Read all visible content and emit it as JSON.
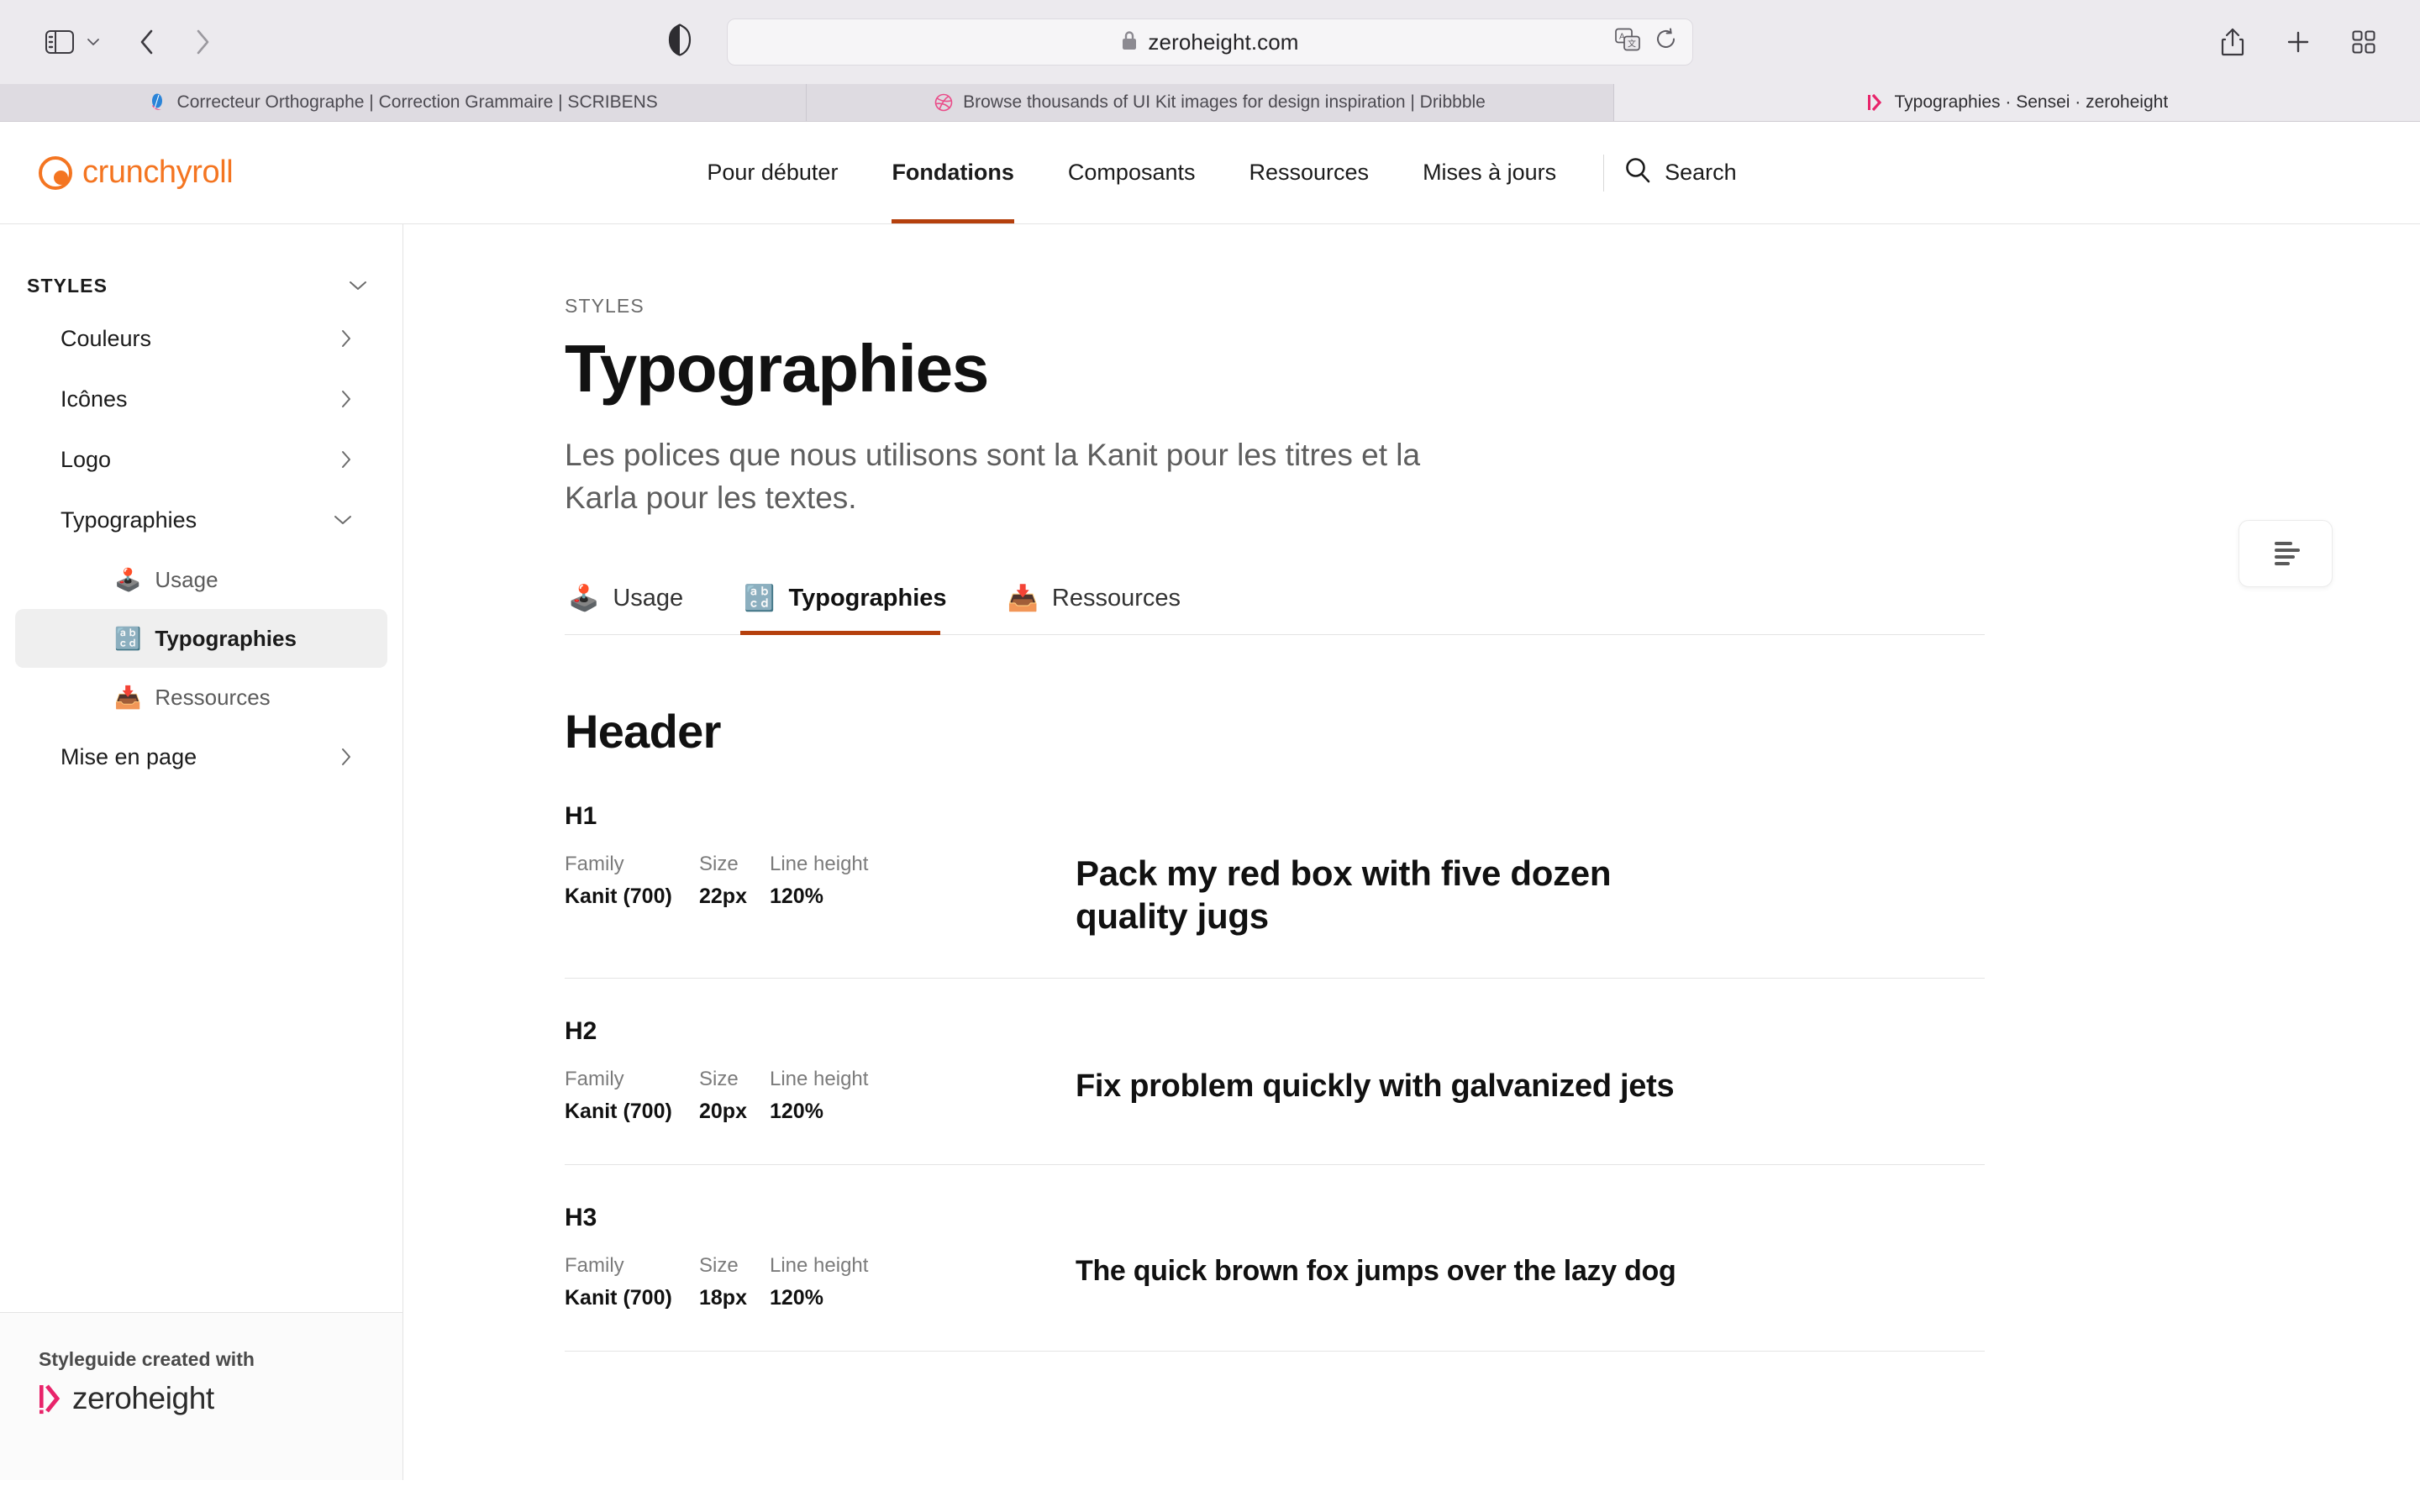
{
  "browser": {
    "url": "zeroheight.com",
    "url_lock_icon": "lock-icon",
    "translate_icon": "translate-icon",
    "reload_icon": "reload-icon",
    "share_icon": "share-icon",
    "new_tab_icon": "plus-icon",
    "tab_overview_icon": "tab-overview-icon",
    "sidebar_icon": "sidebar-toggle-icon",
    "back_icon": "back-arrow-icon",
    "forward_icon": "forward-arrow-icon",
    "shield_icon": "privacy-shield-icon",
    "tabs": [
      {
        "title": "Correcteur Orthographe | Correction Grammaire | SCRIBENS",
        "favicon": "scribens-favicon",
        "active": false
      },
      {
        "title": "Browse thousands of UI Kit images for design inspiration | Dribbble",
        "favicon": "dribbble-favicon",
        "active": false
      },
      {
        "title": "Typographies · Sensei  · zeroheight",
        "favicon": "zeroheight-favicon",
        "active": true
      }
    ]
  },
  "site_header": {
    "brand": "crunchyroll",
    "brand_color": "#F47521",
    "accent_color": "#B5400D",
    "nav": [
      {
        "label": "Pour débuter",
        "active": false
      },
      {
        "label": "Fondations",
        "active": true
      },
      {
        "label": "Composants",
        "active": false
      },
      {
        "label": "Ressources",
        "active": false
      },
      {
        "label": "Mises à jours",
        "active": false
      }
    ],
    "search_label": "Search",
    "search_icon": "search-icon"
  },
  "sidebar": {
    "group_label": "STYLES",
    "group_chevron": "chevron-down-icon",
    "items": [
      {
        "label": "Couleurs",
        "chevron": "chevron-right-icon"
      },
      {
        "label": "Icônes",
        "chevron": "chevron-right-icon"
      },
      {
        "label": "Logo",
        "chevron": "chevron-right-icon"
      },
      {
        "label": "Typographies",
        "chevron": "chevron-down-icon"
      }
    ],
    "sub_items": [
      {
        "label": "Usage",
        "emoji": "🕹️",
        "icon_name": "joystick-emoji",
        "active": false
      },
      {
        "label": "Typographies",
        "emoji": "🔡",
        "icon_name": "abcd-input-emoji",
        "active": true
      },
      {
        "label": "Ressources",
        "emoji": "📥",
        "icon_name": "inbox-tray-emoji",
        "active": false
      }
    ],
    "last_item": {
      "label": "Mise en page",
      "chevron": "chevron-right-icon"
    },
    "footer": {
      "created_with": "Styleguide created with",
      "product": "zeroheight",
      "mark_color": "#E8246A"
    }
  },
  "main": {
    "toc_icon": "text-lines-icon",
    "eyebrow": "STYLES",
    "title": "Typographies",
    "description": "Les polices que nous utilisons sont la Kanit pour les titres et la Karla pour les textes.",
    "tabs": [
      {
        "label": "Usage",
        "emoji": "🕹️",
        "icon_name": "joystick-emoji",
        "active": false
      },
      {
        "label": "Typographies",
        "emoji": "🔡",
        "icon_name": "abcd-input-emoji",
        "active": true
      },
      {
        "label": "Ressources",
        "emoji": "📥",
        "icon_name": "inbox-tray-emoji",
        "active": false
      }
    ],
    "section_title": "Header",
    "spec_headers": {
      "family": "Family",
      "size": "Size",
      "line_height": "Line height"
    },
    "rows": [
      {
        "name": "H1",
        "family": "Kanit (700)",
        "size": "22px",
        "line_height": "120%",
        "sample": "Pack my red box with five dozen quality jugs"
      },
      {
        "name": "H2",
        "family": "Kanit (700)",
        "size": "20px",
        "line_height": "120%",
        "sample": "Fix problem quickly with galvanized jets"
      },
      {
        "name": "H3",
        "family": "Kanit (700)",
        "size": "18px",
        "line_height": "120%",
        "sample": "The quick brown fox jumps over the lazy dog"
      }
    ]
  }
}
